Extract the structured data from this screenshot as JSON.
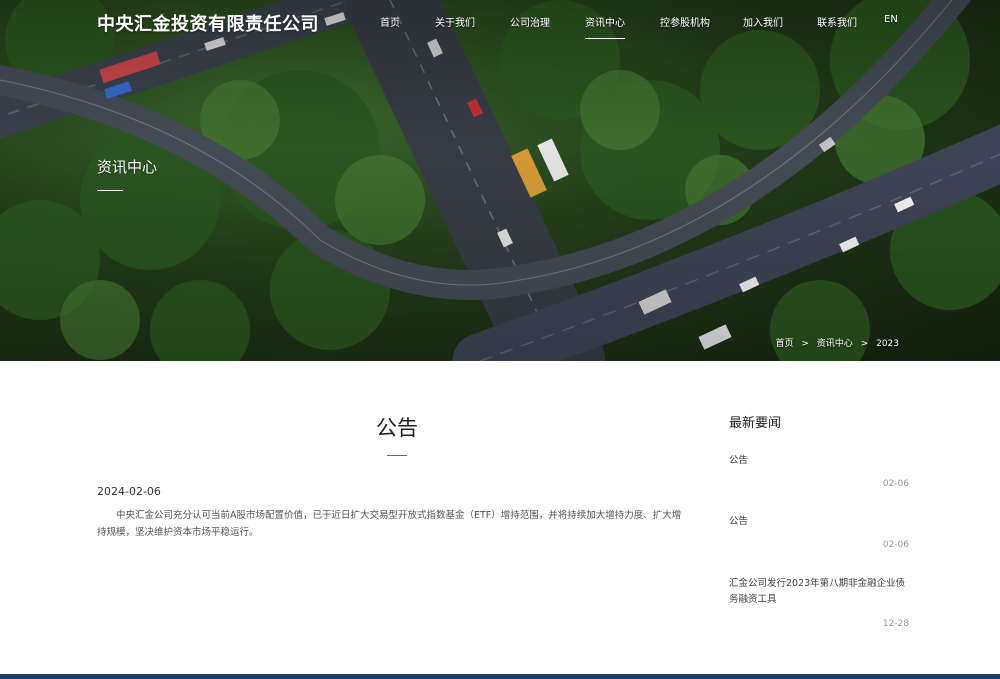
{
  "brand": {
    "name": "中央汇金投资有限责任公司"
  },
  "nav": {
    "items": [
      {
        "label": "首页"
      },
      {
        "label": "关于我们"
      },
      {
        "label": "公司治理"
      },
      {
        "label": "资讯中心"
      },
      {
        "label": "控参股机构"
      },
      {
        "label": "加入我们"
      },
      {
        "label": "联系我们"
      },
      {
        "label": "EN"
      }
    ],
    "active": "资讯中心"
  },
  "hero": {
    "title": "资讯中心"
  },
  "breadcrumb": {
    "home": "首页",
    "section": "资讯中心",
    "current": "2023",
    "separator": ">"
  },
  "article": {
    "title": "公告",
    "date": "2024-02-06",
    "body": "中央汇金公司充分认可当前A股市场配置价值，已于近日扩大交易型开放式指数基金（ETF）增持范围，并将持续加大增持力度、扩大增持规模，坚决维护资本市场平稳运行。"
  },
  "sidebar": {
    "heading": "最新要闻",
    "items": [
      {
        "title": "公告",
        "date": "02-06"
      },
      {
        "title": "公告",
        "date": "02-06"
      },
      {
        "title": "汇金公司发行2023年第八期非金融企业债务融资工具",
        "date": "12-28"
      }
    ]
  },
  "colors": {
    "footer_bar": "#1f3a6b",
    "text_dark": "#222222",
    "date_gray": "#999999"
  }
}
